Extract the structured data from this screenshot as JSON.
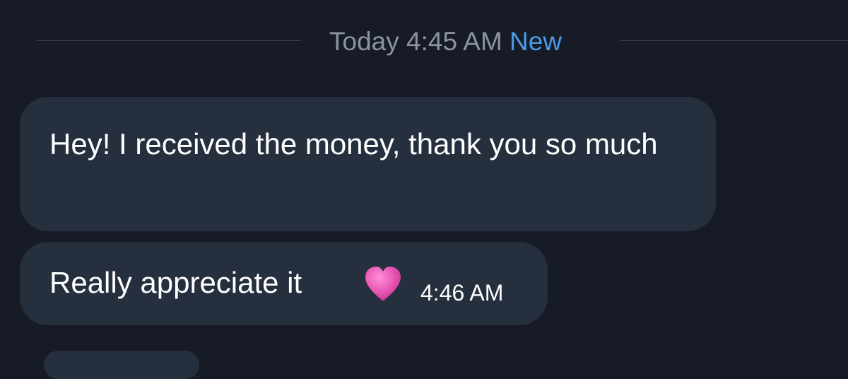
{
  "divider": {
    "time_label": "Today 4:45 AM",
    "new_label": "New"
  },
  "messages": [
    {
      "text": "Hey! I received the money, thank you so much"
    },
    {
      "text": "Really appreciate it",
      "emoji": "pink-heart-icon",
      "time": "4:46 AM"
    }
  ],
  "colors": {
    "background": "#161b26",
    "bubble": "#262f3e",
    "divider_text": "#8b93a1",
    "new_accent": "#4a9ae8",
    "heart": "#e95bb7"
  }
}
